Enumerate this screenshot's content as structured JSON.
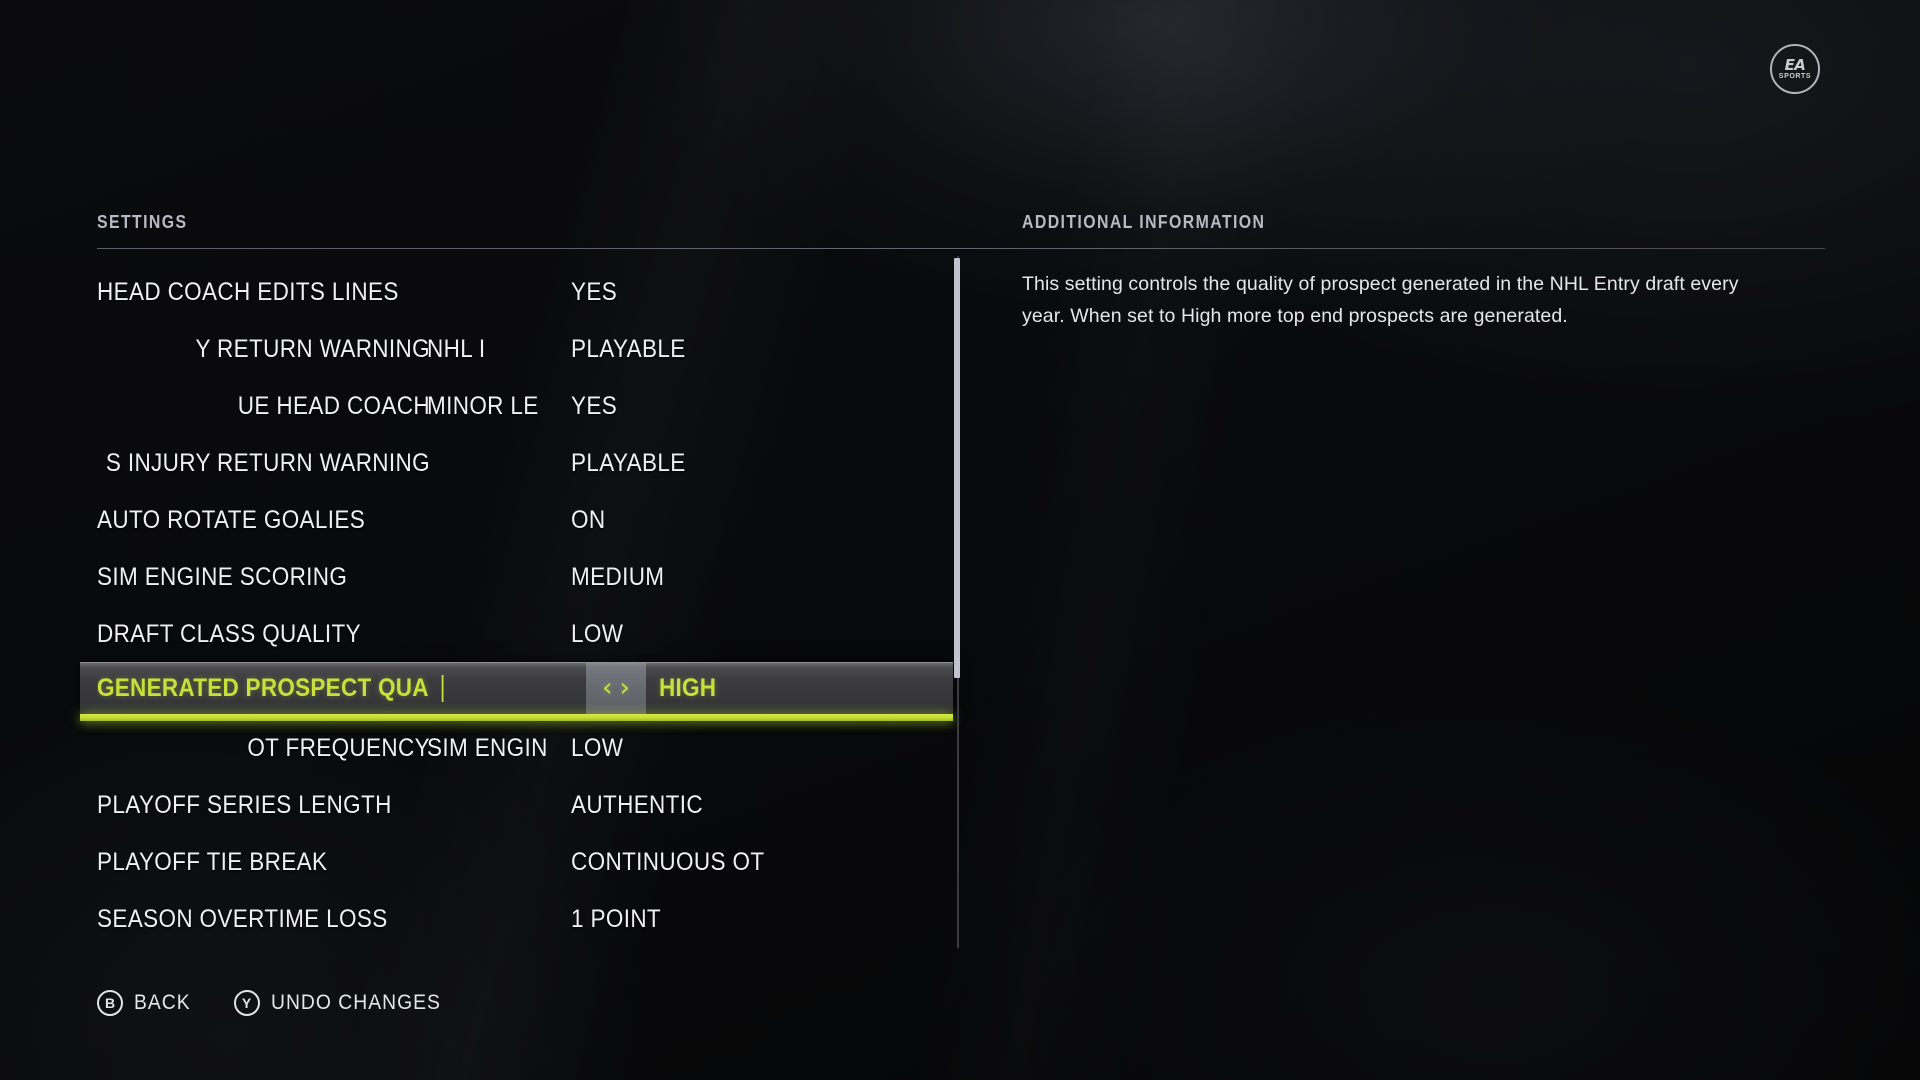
{
  "brand": {
    "logo_top": "EA",
    "logo_bottom": "SPORTS",
    "accent_color": "#c8e03c"
  },
  "headers": {
    "settings": "SETTINGS",
    "additional_information": "ADDITIONAL INFORMATION"
  },
  "settings_rows": [
    {
      "label": "HEAD COACH EDITS LINES",
      "mid": "",
      "value": "YES",
      "clipped": false
    },
    {
      "label": "Y RETURN WARNING",
      "mid": "NHL I",
      "value": "PLAYABLE",
      "clipped": true
    },
    {
      "label": "UE HEAD COACH",
      "mid": "MINOR LE",
      "value": "YES",
      "clipped": true
    },
    {
      "label": "S INJURY RETURN WARNING",
      "mid": "",
      "value": "PLAYABLE",
      "clipped": true
    },
    {
      "label": "AUTO ROTATE GOALIES",
      "mid": "",
      "value": "ON",
      "clipped": false
    },
    {
      "label": "SIM ENGINE SCORING",
      "mid": "",
      "value": "MEDIUM",
      "clipped": false
    },
    {
      "label": "DRAFT CLASS QUALITY",
      "mid": "",
      "value": "LOW",
      "clipped": false
    },
    {
      "label": "GENERATED PROSPECT QUA",
      "mid": "",
      "value": "HIGH",
      "clipped": false,
      "selected": true
    },
    {
      "label": "OT FREQUENCY",
      "mid": "SIM ENGIN",
      "value": "LOW",
      "clipped": true
    },
    {
      "label": "PLAYOFF SERIES LENGTH",
      "mid": "",
      "value": "AUTHENTIC",
      "clipped": false
    },
    {
      "label": "PLAYOFF TIE BREAK",
      "mid": "",
      "value": "CONTINUOUS OT",
      "clipped": false
    },
    {
      "label": "SEASON OVERTIME LOSS",
      "mid": "",
      "value": "1 POINT",
      "clipped": false
    }
  ],
  "selected_row": {
    "label": "GENERATED PROSPECT QUA",
    "value": "HIGH",
    "left_arrow": "‹",
    "right_arrow": "›"
  },
  "info_text": "This setting controls the quality of prospect generated in the NHL Entry draft every year. When set to High more top end prospects are generated.",
  "prompts": [
    {
      "button": "B",
      "label": "BACK"
    },
    {
      "button": "Y",
      "label": "UNDO CHANGES"
    }
  ]
}
